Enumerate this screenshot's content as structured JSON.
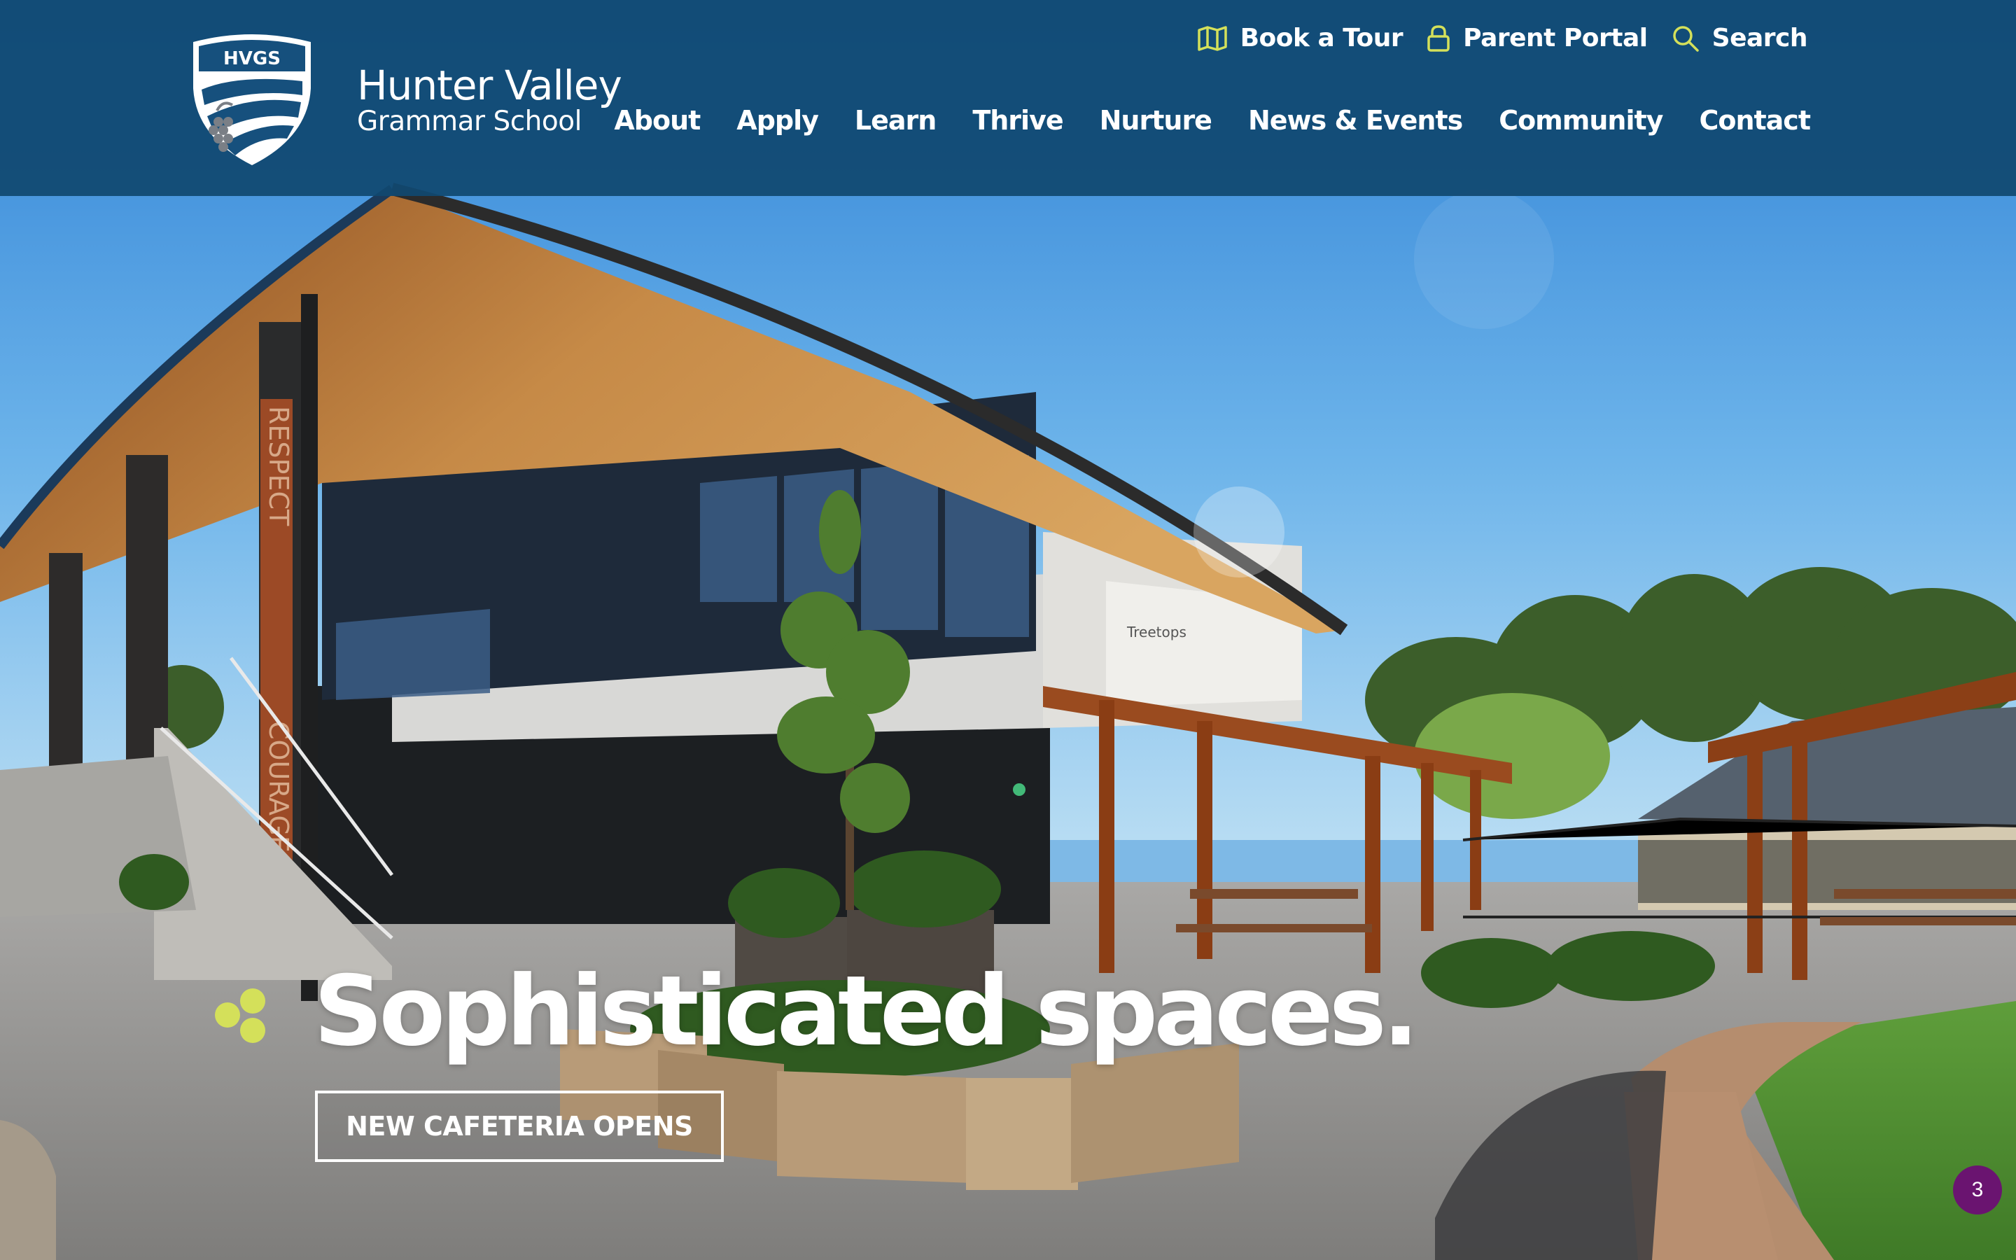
{
  "logo": {
    "crest_text": "HVGS",
    "name_line1": "Hunter Valley",
    "name_line2": "Grammar School"
  },
  "utility_nav": [
    {
      "label": "Book a Tour",
      "icon": "map-icon"
    },
    {
      "label": "Parent Portal",
      "icon": "lock-icon"
    },
    {
      "label": "Search",
      "icon": "search-icon"
    }
  ],
  "main_nav": [
    "About",
    "Apply",
    "Learn",
    "Thrive",
    "Nurture",
    "News & Events",
    "Community",
    "Contact"
  ],
  "hero": {
    "headline": "Sophisticated spaces.",
    "cta_label": "NEW CAFETERIA OPENS",
    "pillar_words": [
      "RESPECT",
      "COURAGE"
    ],
    "building_sign": "Treetops"
  },
  "notification_badge": "3",
  "colors": {
    "header_bg": "#104870",
    "accent_yellow": "#d4e05a",
    "badge_purple": "#6a1470"
  }
}
